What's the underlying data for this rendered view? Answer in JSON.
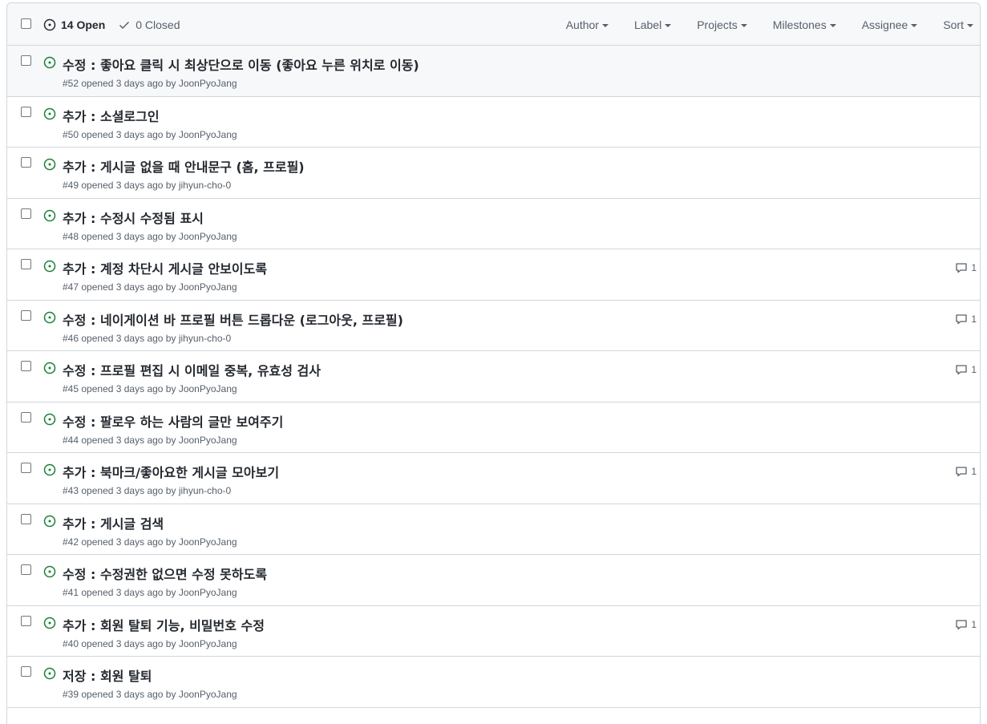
{
  "header": {
    "open_label": "14 Open",
    "closed_label": "0 Closed",
    "filters": [
      {
        "key": "author",
        "label": "Author"
      },
      {
        "key": "label",
        "label": "Label"
      },
      {
        "key": "projects",
        "label": "Projects"
      },
      {
        "key": "milestones",
        "label": "Milestones"
      },
      {
        "key": "assignee",
        "label": "Assignee"
      },
      {
        "key": "sort",
        "label": "Sort"
      }
    ]
  },
  "issues": [
    {
      "title": "수정 : 좋아요 클릭 시 최상단으로 이동 (좋아요 누른 위치로 이동)",
      "number": "#52",
      "opened": "opened 3 days ago by",
      "author": "JoonPyoJang",
      "comments": ""
    },
    {
      "title": "추가 : 소셜로그인",
      "number": "#50",
      "opened": "opened 3 days ago by",
      "author": "JoonPyoJang",
      "comments": ""
    },
    {
      "title": "추가 : 게시글 없을 때 안내문구 (홈, 프로필)",
      "number": "#49",
      "opened": "opened 3 days ago by",
      "author": "jihyun-cho-0",
      "comments": ""
    },
    {
      "title": "추가 : 수정시 수정됨 표시",
      "number": "#48",
      "opened": "opened 3 days ago by",
      "author": "JoonPyoJang",
      "comments": ""
    },
    {
      "title": "추가 : 계정 차단시 게시글 안보이도록",
      "number": "#47",
      "opened": "opened 3 days ago by",
      "author": "JoonPyoJang",
      "comments": "1"
    },
    {
      "title": "수정 : 네이게이션 바 프로필 버튼 드롭다운 (로그아웃, 프로필)",
      "number": "#46",
      "opened": "opened 3 days ago by",
      "author": "jihyun-cho-0",
      "comments": "1"
    },
    {
      "title": "수정 : 프로필 편집 시 이메일 중복, 유효성 검사",
      "number": "#45",
      "opened": "opened 3 days ago by",
      "author": "JoonPyoJang",
      "comments": "1"
    },
    {
      "title": "수정 : 팔로우 하는 사람의 글만 보여주기",
      "number": "#44",
      "opened": "opened 3 days ago by",
      "author": "JoonPyoJang",
      "comments": ""
    },
    {
      "title": "추가 : 북마크/좋아요한 게시글 모아보기",
      "number": "#43",
      "opened": "opened 3 days ago by",
      "author": "jihyun-cho-0",
      "comments": "1"
    },
    {
      "title": "추가 : 게시글 검색",
      "number": "#42",
      "opened": "opened 3 days ago by",
      "author": "JoonPyoJang",
      "comments": ""
    },
    {
      "title": "수정 : 수정권한 없으면 수정 못하도록",
      "number": "#41",
      "opened": "opened 3 days ago by",
      "author": "JoonPyoJang",
      "comments": ""
    },
    {
      "title": "추가 : 회원 탈퇴 기능, 비밀번호 수정",
      "number": "#40",
      "opened": "opened 3 days ago by",
      "author": "JoonPyoJang",
      "comments": "1"
    },
    {
      "title": "저장 : 회원 탈퇴",
      "number": "#39",
      "opened": "opened 3 days ago by",
      "author": "JoonPyoJang",
      "comments": ""
    }
  ],
  "colors": {
    "open_green": "#1a7f37",
    "muted": "#57606a",
    "border": "#d0d7de",
    "header_bg": "#f6f8fa"
  },
  "icons": {
    "open_issue": "issue-opened-icon",
    "closed_check": "check-icon",
    "comment": "comment-icon",
    "caret": "caret-down-icon"
  }
}
